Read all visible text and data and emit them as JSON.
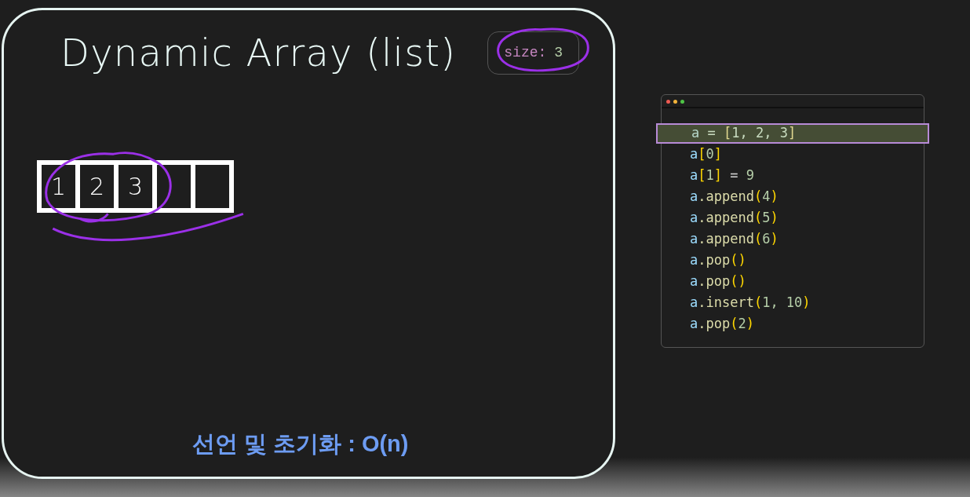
{
  "slide": {
    "title": "Dynamic Array (list)",
    "size_badge": {
      "label": "size:",
      "value": "3"
    },
    "array": [
      {
        "kind": "filled",
        "value": "1"
      },
      {
        "kind": "filled",
        "value": "2"
      },
      {
        "kind": "filled",
        "value": "3"
      },
      {
        "kind": "empty"
      },
      {
        "kind": "empty"
      }
    ],
    "caption": "선언 및 초기화 : O(n)"
  },
  "code_window": {
    "lines": [
      {
        "selected": true,
        "tokens": [
          {
            "kind": "var",
            "text": "a"
          },
          {
            "kind": "op",
            "text": " = "
          },
          {
            "kind": "bracket",
            "text": "["
          },
          {
            "kind": "num",
            "text": "1, 2, 3"
          },
          {
            "kind": "bracket",
            "text": "]"
          }
        ]
      },
      {
        "selected": false,
        "tokens": [
          {
            "kind": "var",
            "text": "a"
          },
          {
            "kind": "bracket",
            "text": "["
          },
          {
            "kind": "num",
            "text": "0"
          },
          {
            "kind": "bracket",
            "text": "]"
          }
        ]
      },
      {
        "selected": false,
        "tokens": [
          {
            "kind": "var",
            "text": "a"
          },
          {
            "kind": "bracket",
            "text": "["
          },
          {
            "kind": "num",
            "text": "1"
          },
          {
            "kind": "bracket",
            "text": "]"
          },
          {
            "kind": "op",
            "text": " = "
          },
          {
            "kind": "num",
            "text": "9"
          }
        ]
      },
      {
        "selected": false,
        "tokens": [
          {
            "kind": "var",
            "text": "a"
          },
          {
            "kind": "func",
            "text": ".append"
          },
          {
            "kind": "bracket",
            "text": "("
          },
          {
            "kind": "num",
            "text": "4"
          },
          {
            "kind": "bracket",
            "text": ")"
          }
        ]
      },
      {
        "selected": false,
        "tokens": [
          {
            "kind": "var",
            "text": "a"
          },
          {
            "kind": "func",
            "text": ".append"
          },
          {
            "kind": "bracket",
            "text": "("
          },
          {
            "kind": "num",
            "text": "5"
          },
          {
            "kind": "bracket",
            "text": ")"
          }
        ]
      },
      {
        "selected": false,
        "tokens": [
          {
            "kind": "var",
            "text": "a"
          },
          {
            "kind": "func",
            "text": ".append"
          },
          {
            "kind": "bracket",
            "text": "("
          },
          {
            "kind": "num",
            "text": "6"
          },
          {
            "kind": "bracket",
            "text": ")"
          }
        ]
      },
      {
        "selected": false,
        "tokens": [
          {
            "kind": "var",
            "text": "a"
          },
          {
            "kind": "func",
            "text": ".pop"
          },
          {
            "kind": "bracket",
            "text": "()"
          }
        ]
      },
      {
        "selected": false,
        "tokens": [
          {
            "kind": "var",
            "text": "a"
          },
          {
            "kind": "func",
            "text": ".pop"
          },
          {
            "kind": "bracket",
            "text": "()"
          }
        ]
      },
      {
        "selected": false,
        "tokens": [
          {
            "kind": "var",
            "text": "a"
          },
          {
            "kind": "func",
            "text": ".insert"
          },
          {
            "kind": "bracket",
            "text": "("
          },
          {
            "kind": "num",
            "text": "1, 10"
          },
          {
            "kind": "bracket",
            "text": ")"
          }
        ]
      },
      {
        "selected": false,
        "tokens": [
          {
            "kind": "var",
            "text": "a"
          },
          {
            "kind": "func",
            "text": ".pop"
          },
          {
            "kind": "bracket",
            "text": "("
          },
          {
            "kind": "num",
            "text": "2"
          },
          {
            "kind": "bracket",
            "text": ")"
          }
        ]
      }
    ]
  }
}
